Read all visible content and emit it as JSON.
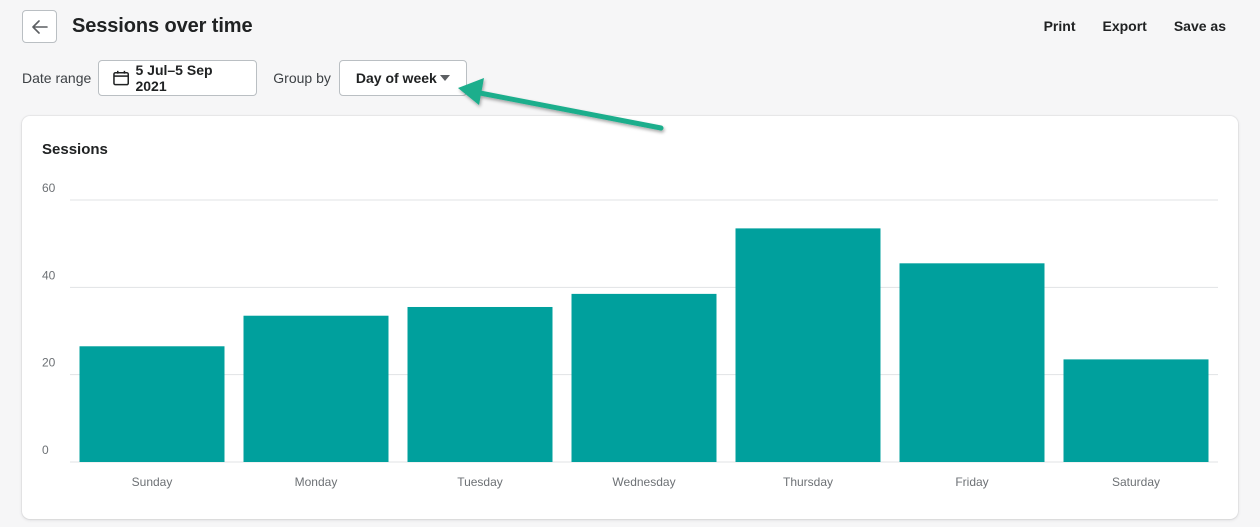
{
  "header": {
    "title": "Sessions over time",
    "actions": {
      "print": "Print",
      "export": "Export",
      "save_as": "Save as"
    }
  },
  "filters": {
    "date_range_label": "Date range",
    "date_range_value": "5 Jul–5 Sep 2021",
    "group_by_label": "Group by",
    "group_by_value": "Day of week"
  },
  "icons": {
    "back": "arrow-left-icon",
    "calendar": "calendar-icon",
    "dropdown": "caret-down-icon"
  },
  "colors": {
    "bar": "#00a09d",
    "arrow": "#1aae8c",
    "grid": "#e1e3e5",
    "tick": "#6d7175"
  },
  "chart_data": {
    "type": "bar",
    "title": "Sessions",
    "categories": [
      "Sunday",
      "Monday",
      "Tuesday",
      "Wednesday",
      "Thursday",
      "Friday",
      "Saturday"
    ],
    "values": [
      26.5,
      33.5,
      35.5,
      38.5,
      53.5,
      45.5,
      23.5
    ],
    "yticks": [
      0,
      20,
      40,
      60
    ],
    "ylim": [
      0,
      60
    ],
    "grid": true
  }
}
